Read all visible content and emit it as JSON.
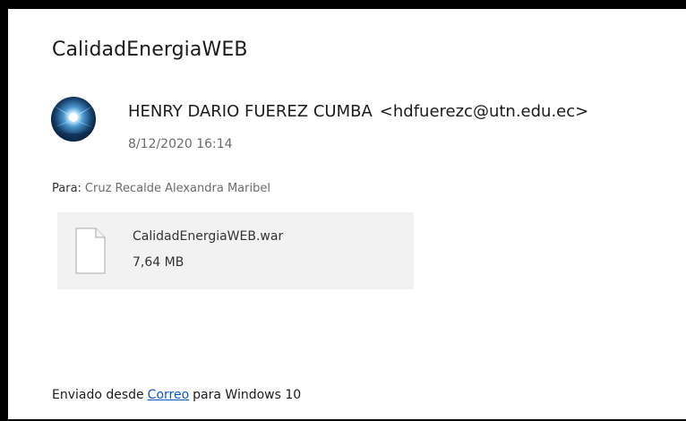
{
  "email": {
    "subject": "CalidadEnergiaWEB",
    "sender": {
      "name": "HENRY DARIO FUEREZ CUMBA",
      "email": "<hdfuerezc@utn.edu.ec>"
    },
    "datetime": "8/12/2020 16:14",
    "to": {
      "label": "Para:",
      "value": "Cruz Recalde Alexandra Maribel"
    },
    "attachment": {
      "name": "CalidadEnergiaWEB.war",
      "size": "7,64 MB",
      "icon": "file-icon"
    },
    "signature": {
      "prefix": "Enviado desde",
      "link": "Correo",
      "suffix": "para Windows 10"
    }
  },
  "colors": {
    "frame": "#000000",
    "link": "#0b57d0",
    "muted": "#6b6b6b",
    "attachment_bg": "#f2f2f2"
  }
}
